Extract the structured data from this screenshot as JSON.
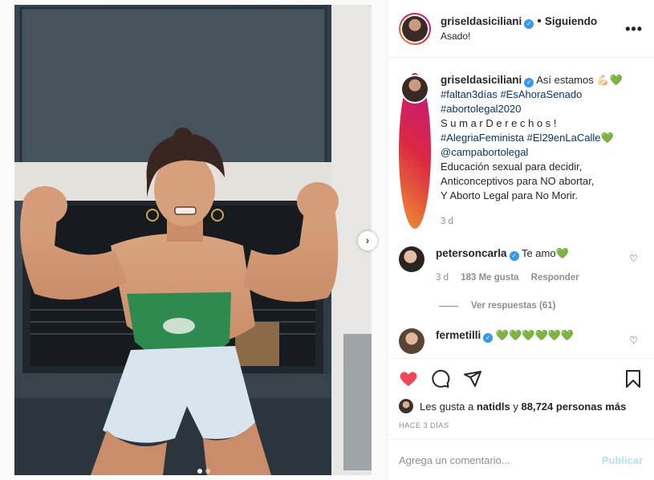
{
  "header": {
    "username": "griseldasiciliani",
    "follow_status": "Siguiendo",
    "location": "Asado!",
    "more_icon": "more-horizontal-icon"
  },
  "caption": {
    "username": "griseldasiciliani",
    "lines": [
      "Así estamos 💪🏻💚",
      "#faltan3días #EsAhoraSenado",
      "#abortolegal2020",
      "S u m a r D e r e c h o s !",
      "#AlegriaFeminista #El29enLaCalle💚",
      "@campabortolegal",
      "Educación sexual para decidir,",
      "Anticonceptivos para NO abortar,",
      "Y Aborto Legal para No Morir."
    ],
    "time": "3 d"
  },
  "comments": [
    {
      "username": "petersoncarla",
      "text": "Te amo💚",
      "time": "3 d",
      "likes": "183 Me gusta",
      "reply": "Responder",
      "view_replies": "Ver respuestas (61)"
    },
    {
      "username": "fermetilli",
      "text": "💚💚💚💚💚💚"
    }
  ],
  "likes": {
    "prefix": "Les gusta a",
    "user": "natidls",
    "connector": "y",
    "count": "88,724 personas más"
  },
  "post_age": "HACE 3 DÍAS",
  "add_comment": {
    "placeholder": "Agrega un comentario...",
    "publish_label": "Publicar"
  },
  "carousel": {
    "total": 2,
    "current": 1
  },
  "colors": {
    "like_red": "#ed4956",
    "link_blue": "#00376b",
    "verified_blue": "#3897f0",
    "publish_disabled": "#b2dffc"
  }
}
